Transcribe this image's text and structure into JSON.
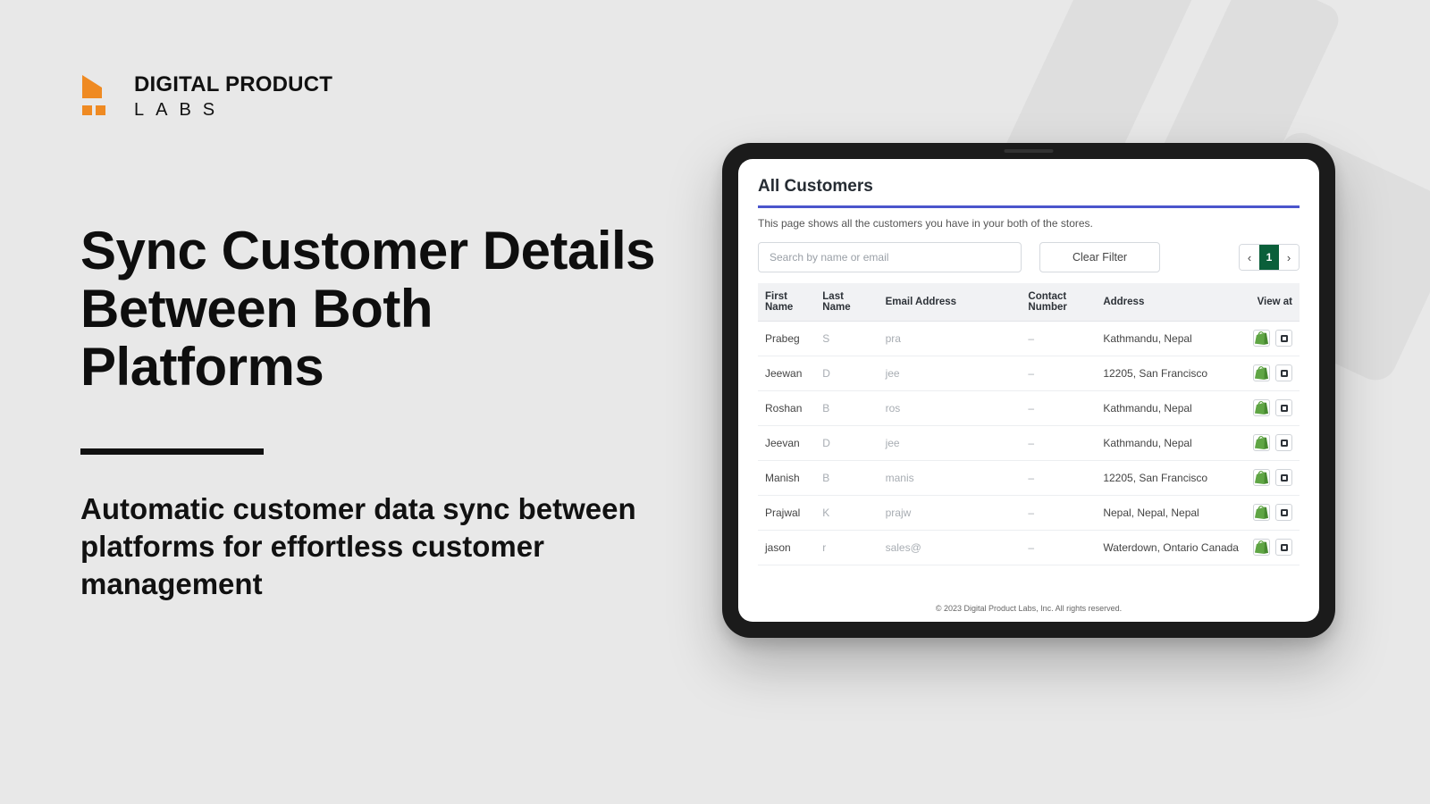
{
  "brand": {
    "line1": "DIGITAL PRODUCT",
    "line2": "LABS"
  },
  "hero": {
    "headline_1": "Sync Customer Details",
    "headline_2": "Between Both Platforms",
    "subhead": "Automatic customer data sync between platforms for effortless customer management"
  },
  "panel": {
    "title": "All Customers",
    "description": "This page shows all the customers you have in your both of the stores.",
    "search_placeholder": "Search by name or email",
    "clear_filter_label": "Clear Filter",
    "pagination": {
      "prev": "‹",
      "current": "1",
      "next": "›"
    },
    "columns": {
      "first_name": "First Name",
      "last_name": "Last Name",
      "email": "Email Address",
      "contact": "Contact Number",
      "address": "Address",
      "view_at": "View at"
    },
    "rows": [
      {
        "first": "Prabeg",
        "last": "S",
        "email": "pra",
        "contact": "–",
        "address": "Kathmandu, Nepal"
      },
      {
        "first": "Jeewan",
        "last": "D",
        "email": "jee",
        "contact": "–",
        "address": "12205, San Francisco"
      },
      {
        "first": "Roshan",
        "last": "B",
        "email": "ros",
        "contact": "–",
        "address": "Kathmandu, Nepal"
      },
      {
        "first": "Jeevan",
        "last": "D",
        "email": "jee",
        "contact": "–",
        "address": "Kathmandu, Nepal"
      },
      {
        "first": "Manish",
        "last": "B",
        "email": "manis",
        "contact": "–",
        "address": "12205, San Francisco"
      },
      {
        "first": "Prajwal",
        "last": "K",
        "email": "prajw",
        "contact": "–",
        "address": "Nepal, Nepal, Nepal"
      },
      {
        "first": "jason",
        "last": "r",
        "email": "sales@",
        "contact": "–",
        "address": "Waterdown, Ontario Canada"
      }
    ]
  },
  "footer": "© 2023 Digital Product Labs, Inc. All rights reserved."
}
